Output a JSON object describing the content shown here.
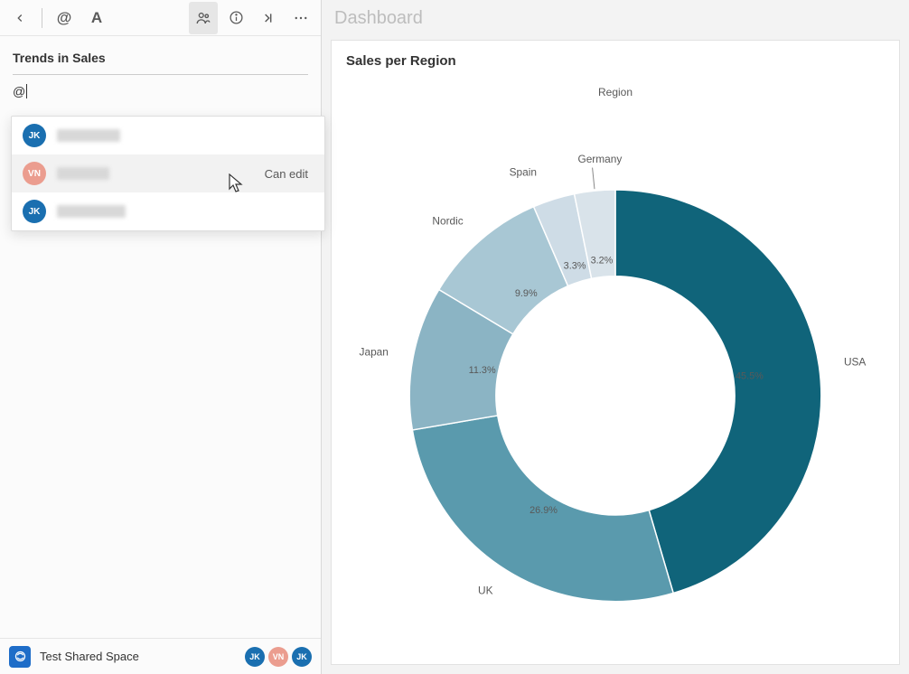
{
  "sidebar": {
    "toolbar_icons": {
      "back": "back-icon",
      "mention": "mention-icon",
      "text_style": "text-style-icon",
      "people": "people-icon",
      "info": "info-icon",
      "collapse": "collapse-icon",
      "more": "more-icon"
    },
    "note": {
      "title": "Trends in Sales",
      "input_value": "@"
    },
    "mention_suggestions": [
      {
        "initials": "JK",
        "color": "#1a6fb0",
        "permission": ""
      },
      {
        "initials": "VN",
        "color": "#eb9d8f",
        "permission": "Can edit"
      },
      {
        "initials": "JK",
        "color": "#1a6fb0",
        "permission": ""
      }
    ],
    "footer": {
      "space_name": "Test Shared Space",
      "avatars": [
        {
          "initials": "JK",
          "color": "#1a6fb0"
        },
        {
          "initials": "VN",
          "color": "#eb9d8f"
        },
        {
          "initials": "JK",
          "color": "#1a6fb0"
        }
      ]
    }
  },
  "main": {
    "header_title": "Dashboard",
    "chart_title": "Sales per Region",
    "legend_title": "Region"
  },
  "chart_data": {
    "type": "pie",
    "title": "Sales per Region",
    "legend_title": "Region",
    "categories": [
      "USA",
      "UK",
      "Japan",
      "Nordic",
      "Spain",
      "Germany"
    ],
    "values": [
      45.5,
      26.9,
      11.3,
      9.9,
      3.3,
      3.2
    ],
    "colors": [
      "#10647a",
      "#5a9aad",
      "#8bb4c4",
      "#a8c7d4",
      "#cedce6",
      "#d9e3ea"
    ],
    "inner_radius_ratio": 0.58
  }
}
